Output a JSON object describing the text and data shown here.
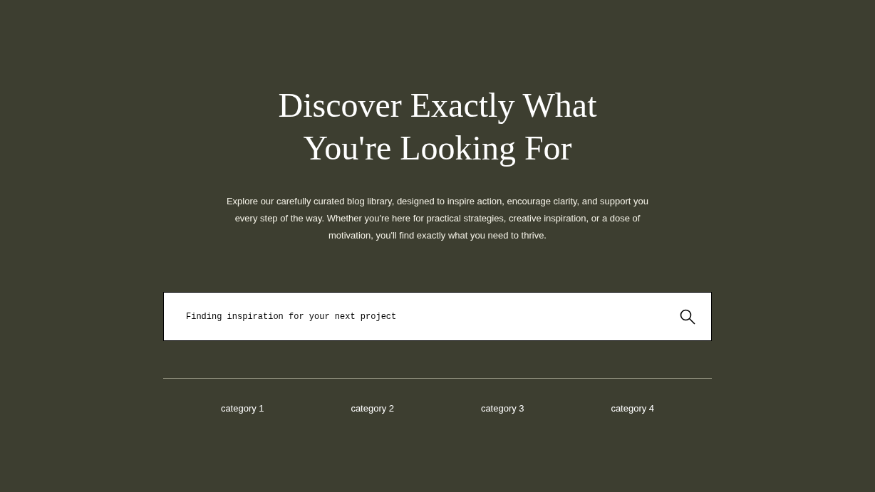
{
  "hero": {
    "title": "Discover Exactly What You're Looking For",
    "description": "Explore our carefully curated blog library, designed to inspire action, encourage clarity, and support you every step of the way. Whether you're here for practical strategies, creative inspiration, or a dose of motivation, you'll find exactly what you need to thrive."
  },
  "search": {
    "placeholder": "Finding inspiration for your next project"
  },
  "categories": [
    "category 1",
    "category 2",
    "category 3",
    "category 4"
  ]
}
